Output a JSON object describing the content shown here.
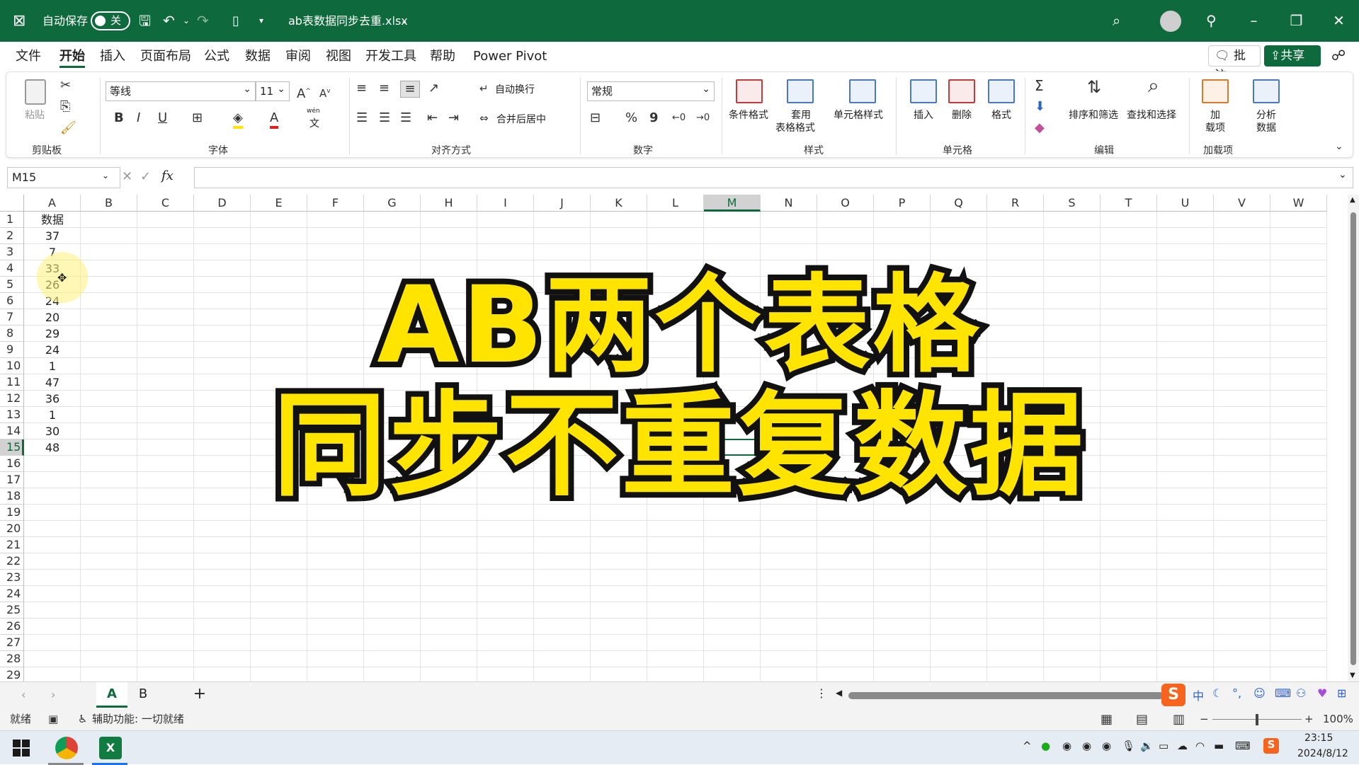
{
  "titlebar": {
    "app_icon": "excel-icon",
    "autosave_label": "自动保存",
    "autosave_state": "关",
    "filename": "ab表数据同步去重.xlsx",
    "colors": {
      "bg": "#0e6a3c"
    }
  },
  "menu": {
    "items": [
      "文件",
      "开始",
      "插入",
      "页面布局",
      "公式",
      "数据",
      "审阅",
      "视图",
      "开发工具",
      "帮助",
      "Power Pivot"
    ],
    "active": "开始",
    "comments": "批注",
    "share": "共享"
  },
  "ribbon": {
    "clipboard": {
      "paste": "粘贴",
      "label": "剪贴板"
    },
    "font": {
      "family": "等线",
      "size": "11",
      "label": "字体",
      "wen": "wén",
      "wen_char": "文"
    },
    "align": {
      "wrap": "自动换行",
      "merge": "合并后居中",
      "label": "对齐方式"
    },
    "number": {
      "format": "常规",
      "percent": "%",
      "comma": "9",
      "label": "数字"
    },
    "styles": {
      "cond": "条件格式",
      "table1": "套用",
      "table2": "表格格式",
      "cell": "单元格样式",
      "label": "样式"
    },
    "cells": {
      "insert": "插入",
      "delete": "删除",
      "format": "格式",
      "label": "单元格"
    },
    "editing": {
      "sort": "排序和筛选",
      "find": "查找和选择",
      "label": "编辑"
    },
    "addins": {
      "btn1": "加",
      "btn2": "载项",
      "analyze1": "分析",
      "analyze2": "数据",
      "label": "加载项"
    }
  },
  "formula": {
    "namebox": "M15",
    "fx": "fx",
    "value": ""
  },
  "grid": {
    "columns": [
      "A",
      "B",
      "C",
      "D",
      "E",
      "F",
      "G",
      "H",
      "I",
      "J",
      "K",
      "L",
      "M",
      "N",
      "O",
      "P",
      "Q",
      "R",
      "S",
      "T",
      "U",
      "V",
      "W"
    ],
    "selected_column": "M",
    "rows": [
      "1",
      "2",
      "3",
      "4",
      "5",
      "6",
      "7",
      "8",
      "9",
      "10",
      "11",
      "12",
      "13",
      "14",
      "15",
      "16",
      "17",
      "18",
      "19",
      "20",
      "21",
      "22",
      "23",
      "24",
      "25",
      "26",
      "27",
      "28",
      "29"
    ],
    "selected_row": "15",
    "col_a_values": [
      "数据",
      "37",
      "7",
      "33",
      "26",
      "24",
      "20",
      "29",
      "24",
      "1",
      "47",
      "36",
      "1",
      "30",
      "48"
    ]
  },
  "overlay": {
    "line1": "AB两个表格",
    "line2": "同步不重复数据",
    "color": "#ffe400"
  },
  "sheets": {
    "tabs": [
      "A",
      "B"
    ],
    "active": "A",
    "add": "+"
  },
  "status": {
    "ready": "就绪",
    "accessibility": "辅助功能: 一切就绪",
    "zoom": "100%"
  },
  "taskbar": {
    "time": "23:15",
    "date": "2024/8/12",
    "ime_lang": "中",
    "ime_brand": "S",
    "chevron": "^"
  }
}
